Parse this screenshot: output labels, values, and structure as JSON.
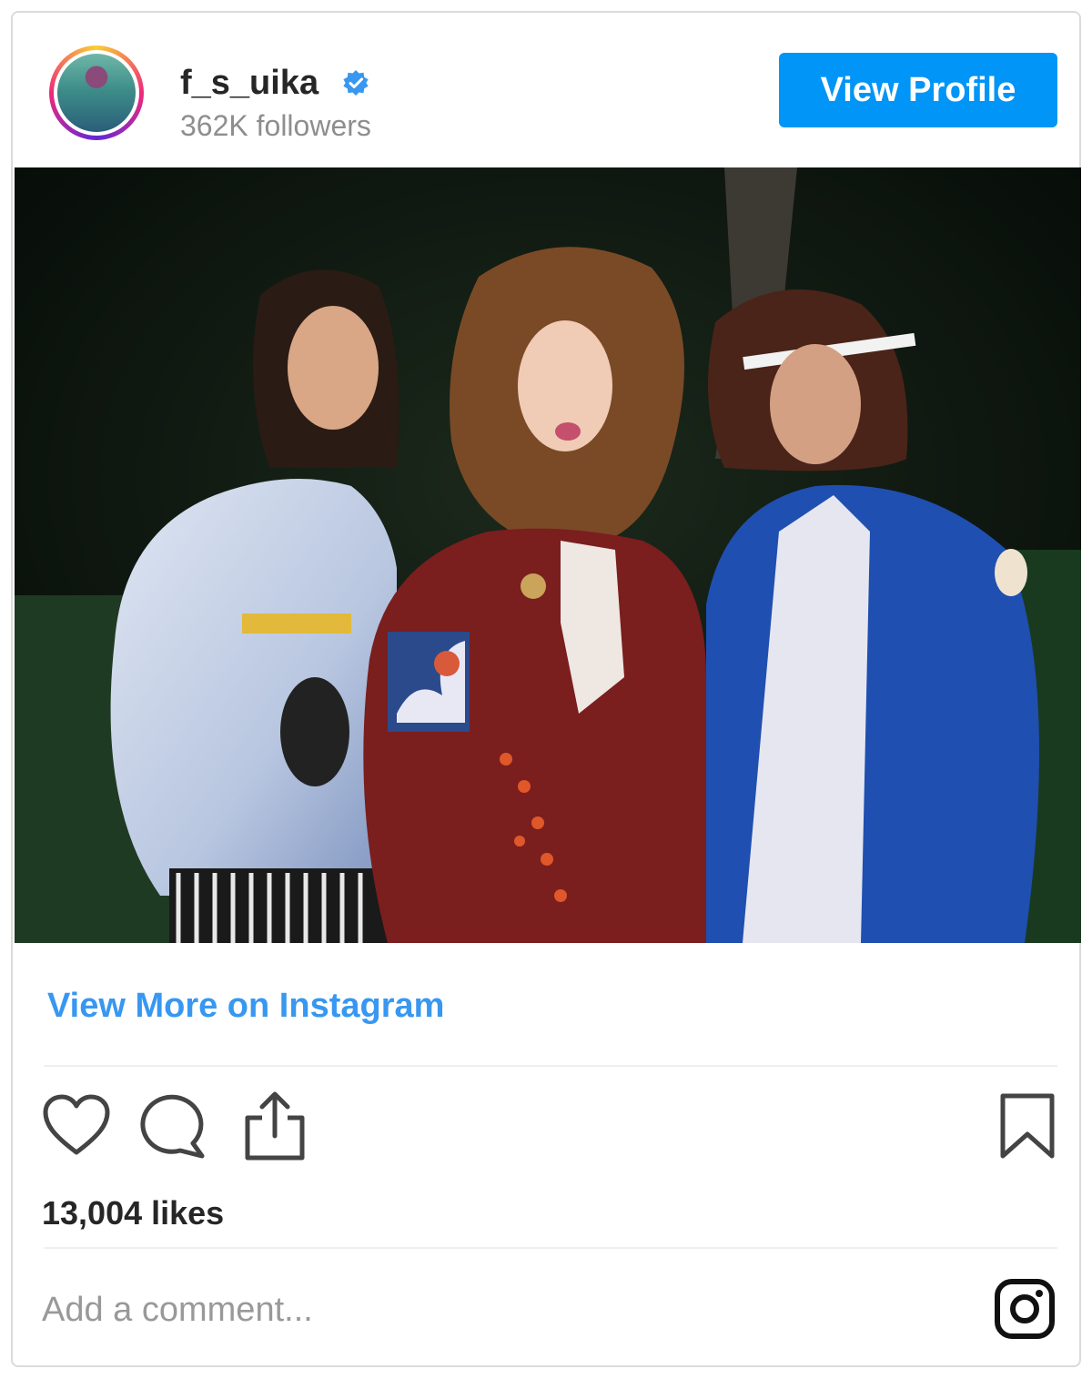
{
  "header": {
    "username": "f_s_uika",
    "followers": "362K followers",
    "view_profile_label": "View Profile",
    "avatar_icon": "avatar-image",
    "verified_icon": "verified-badge-icon"
  },
  "post": {
    "image_icon": "post-photo",
    "view_more_label": "View More on Instagram"
  },
  "actions": {
    "like_icon": "heart-icon",
    "comment_icon": "comment-bubble-icon",
    "share_icon": "share-icon",
    "save_icon": "bookmark-icon"
  },
  "likes_text": "13,004 likes",
  "comment": {
    "placeholder": "Add a comment...",
    "logo_icon": "instagram-logo-icon"
  },
  "colors": {
    "accent": "#0095f6",
    "link": "#3897f0",
    "verified": "#3897f0",
    "border": "#dbdbdb"
  }
}
